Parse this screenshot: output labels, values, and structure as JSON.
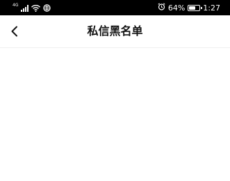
{
  "status_bar": {
    "network_label": "4G",
    "battery_percent": "64%",
    "battery_level": 0.64,
    "time": "1:27",
    "icons": [
      "signal-icon",
      "wifi-icon",
      "messaging-icon",
      "alarm-icon",
      "battery-icon"
    ]
  },
  "header": {
    "title": "私信黑名单",
    "back_icon": "back-arrow-icon"
  },
  "colors": {
    "status_bar_bg": "#000000",
    "background": "#ffffff",
    "title_text": "#111111"
  }
}
